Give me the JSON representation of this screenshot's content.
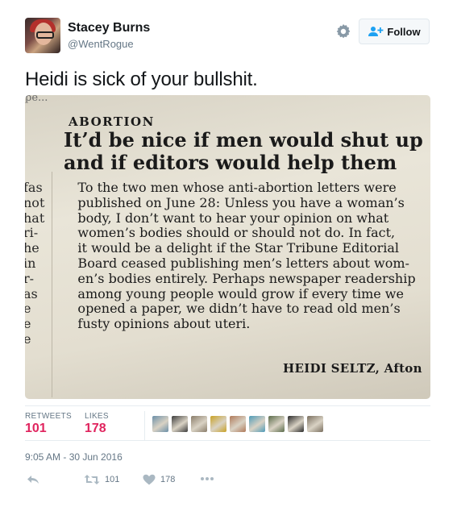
{
  "author": {
    "name": "Stacey Burns",
    "handle": "@WentRogue"
  },
  "header": {
    "follow_label": "Follow"
  },
  "tweet": {
    "text": "Heidi is sick of your bullshit."
  },
  "clipping": {
    "top_fragment": "pe...",
    "kicker": "ABORTION",
    "headline": "It’d be nice if men would shut up\nand if editors would help them",
    "margin_text": "fas\nnot\nhat\nri-\nhe\nin\nr-\nas\ne\ne\ne",
    "body": "     To the two men whose anti-abortion letters were\n     published on June 28: Unless you have a woman’s\n     body, I don’t want to hear your opinion on what\n     women’s bodies should or should not do. In fact,\n     it would be a delight if the Star Tribune Editorial\n     Board ceased publishing men’s letters about wom-\n     en’s bodies entirely. Perhaps newspaper readership\n     among young people would grow if every time we\n     opened a paper, we didn’t have to read old men’s\n     fusty opinions about uteri.",
    "signature": "HEIDI SELTZ, Afton"
  },
  "stats": {
    "retweets_label": "RETWEETS",
    "retweets_value": "101",
    "likes_label": "LIKES",
    "likes_value": "178"
  },
  "likers": [
    {
      "name": "liker-1",
      "color": "#6b8fa8"
    },
    {
      "name": "liker-2",
      "color": "#3d3d3d"
    },
    {
      "name": "liker-3",
      "color": "#8a7d6a"
    },
    {
      "name": "liker-4",
      "color": "#c9a227"
    },
    {
      "name": "liker-5",
      "color": "#b07a5a"
    },
    {
      "name": "liker-6",
      "color": "#4f9bb8"
    },
    {
      "name": "liker-7",
      "color": "#5a6b4a"
    },
    {
      "name": "liker-8",
      "color": "#2a2a2a"
    },
    {
      "name": "liker-9",
      "color": "#7a6f5f"
    }
  ],
  "timestamp": "9:05 AM - 30 Jun 2016",
  "actions": {
    "reply_icon": "reply-icon",
    "retweet_count": "101",
    "like_count": "178",
    "more_icon": "more-icon"
  },
  "colors": {
    "likes_accent": "#e0245e",
    "text_secondary": "#657786",
    "border": "#e1e8ed"
  }
}
